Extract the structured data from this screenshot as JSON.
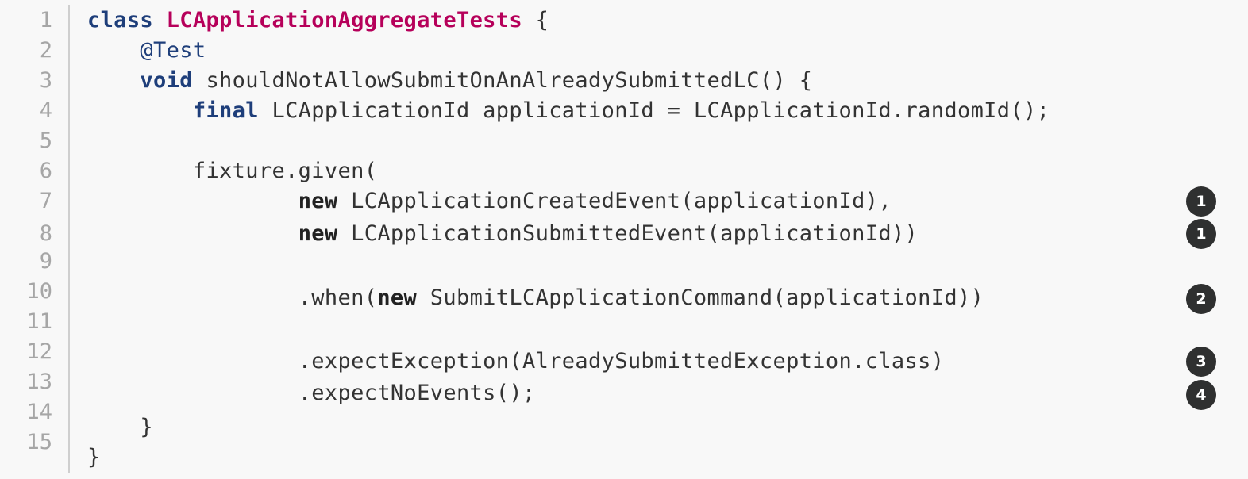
{
  "line_numbers": [
    "1",
    "2",
    "3",
    "4",
    "5",
    "6",
    "7",
    "8",
    "9",
    "10",
    "11",
    "12",
    "13",
    "14",
    "15"
  ],
  "code": {
    "l1": {
      "kw": "class",
      "cls": "LCApplicationAggregateTests",
      "rest": " {"
    },
    "l2": {
      "ann": "@Test"
    },
    "l3": {
      "kw": "void",
      "rest": " shouldNotAllowSubmitOnAnAlreadySubmittedLC() {"
    },
    "l4": {
      "kw": "final",
      "rest": " LCApplicationId applicationId = LCApplicationId.randomId();"
    },
    "l6": {
      "rest": "fixture.given("
    },
    "l7": {
      "kw": "new",
      "rest": " LCApplicationCreatedEvent(applicationId),"
    },
    "l8": {
      "kw": "new",
      "rest": " LCApplicationSubmittedEvent(applicationId))"
    },
    "l10": {
      "pre": ".when(",
      "kw": "new",
      "rest": " SubmitLCApplicationCommand(applicationId))"
    },
    "l12": {
      "rest": ".expectException(AlreadySubmittedException.class)"
    },
    "l13": {
      "rest": ".expectNoEvents();"
    },
    "l15": {
      "rest": "}"
    },
    "l16": {
      "rest": "}"
    }
  },
  "callouts": [
    "1",
    "1",
    "2",
    "3",
    "4"
  ]
}
